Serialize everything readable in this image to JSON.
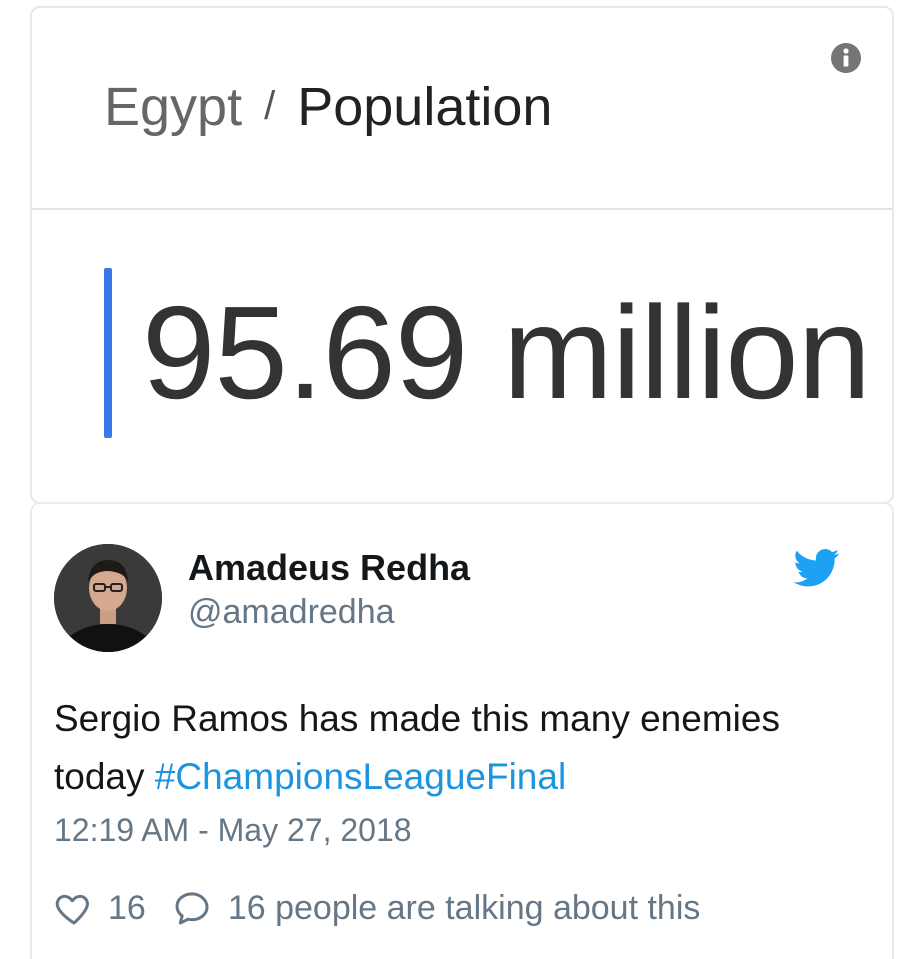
{
  "population_card": {
    "country": "Egypt",
    "separator": "/",
    "topic": "Population",
    "value": "95.69 million",
    "info_icon": "info-icon",
    "accent_color": "#3b78e7"
  },
  "tweet": {
    "author_name": "Amadeus Redha",
    "author_handle": "@amadredha",
    "brand_icon": "twitter-bird-icon",
    "brand_color": "#1da1f2",
    "text_before_hashtag": "Sergio Ramos has made this many enemies today ",
    "hashtag": "#ChampionsLeagueFinal",
    "hashtag_color": "#1b95e0",
    "timestamp": "12:19 AM - May 27, 2018",
    "like_icon": "heart-icon",
    "like_count": "16",
    "reply_icon": "speech-bubble-icon",
    "talking_text": "16 people are talking about this"
  }
}
